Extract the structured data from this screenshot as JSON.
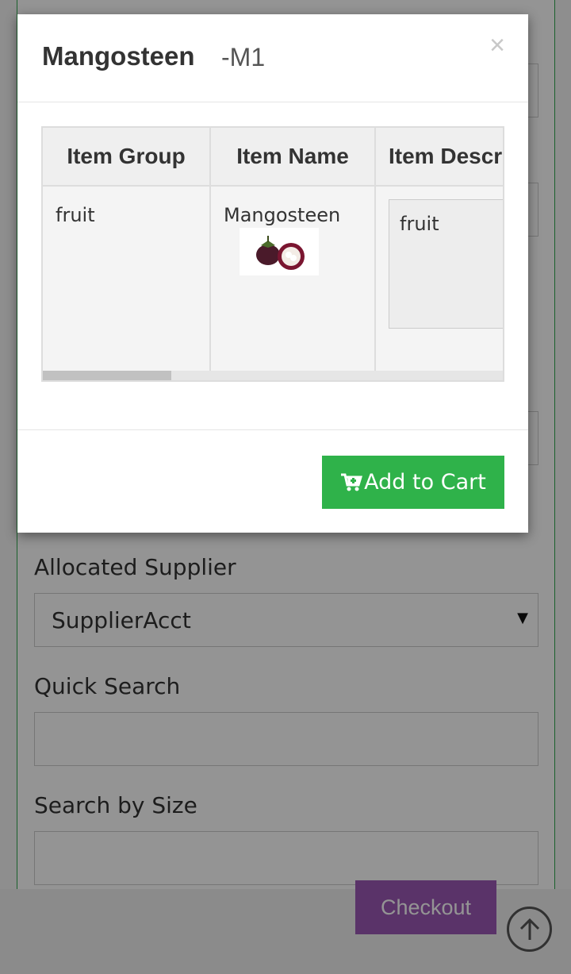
{
  "background": {
    "fields": {
      "allocated_supplier_label": "Allocated Supplier",
      "allocated_supplier_value": "SupplierAcct",
      "quick_search_label": "Quick Search",
      "quick_search_value": "",
      "search_by_size_label": "Search by Size",
      "search_by_size_value": ""
    },
    "checkout_label": "Checkout",
    "scroll_top_icon": "arrow-up-circle-icon"
  },
  "modal": {
    "title": "Mangosteen",
    "code": "-M1",
    "close_glyph": "×",
    "table": {
      "headers": [
        "Item Group",
        "Item Name",
        "Item Descr"
      ],
      "row": {
        "item_group": "fruit",
        "item_name": "Mangosteen",
        "item_description": "fruit"
      },
      "horizontal_scroll_fraction": 0.28
    },
    "add_to_cart_label": "Add to Cart",
    "add_to_cart_icon": "cart-plus-icon"
  },
  "colors": {
    "panel_border": "#2fa84f",
    "add_to_cart": "#2fb24a",
    "checkout": "#9b59b6"
  }
}
